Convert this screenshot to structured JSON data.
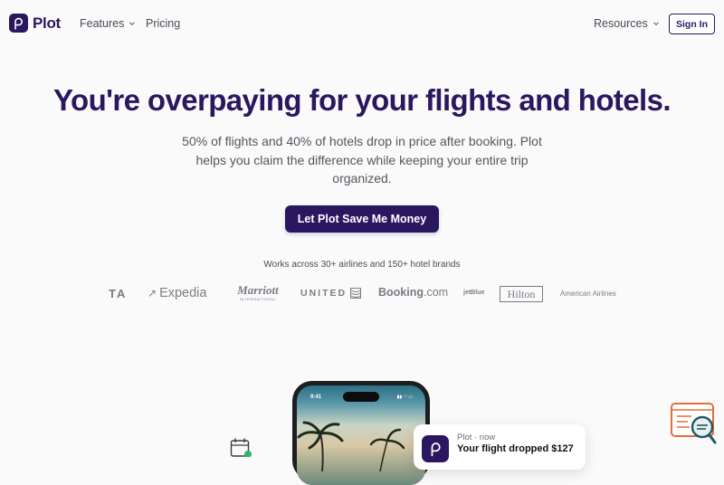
{
  "nav": {
    "logo_text": "Plot",
    "features_label": "Features",
    "pricing_label": "Pricing",
    "resources_label": "Resources",
    "signin_label": "Sign In"
  },
  "hero": {
    "title": "You're overpaying for your flights and hotels.",
    "subtitle": "50% of flights and 40% of hotels drop in price after booking. Plot helps you claim the difference while keeping your entire trip organized.",
    "cta_label": "Let Plot Save Me Money"
  },
  "brands": {
    "caption": "Works across 30+ airlines and 150+ hotel brands",
    "items": {
      "ta": "TA",
      "expedia": "Expedia",
      "marriott": "Marriott",
      "marriott_sub": "INTERNATIONAL",
      "united": "UNITED",
      "booking": "Booking",
      "booking_suffix": ".com",
      "jetblue": "jetBlue",
      "hilton": "Hilton",
      "american": "American Airlines"
    }
  },
  "phone": {
    "time": "9:41"
  },
  "notification": {
    "app": "Plot · now",
    "title": "Your flight dropped $127"
  },
  "colors": {
    "brand": "#2b1760",
    "background": "#fafafb",
    "widget_accent": "#e46b3a",
    "widget_teal": "#1f5a66"
  },
  "icons": [
    "plot-logo-icon",
    "chevron-down-icon",
    "globe-icon",
    "calendar-icon",
    "chat-widget-icon"
  ]
}
